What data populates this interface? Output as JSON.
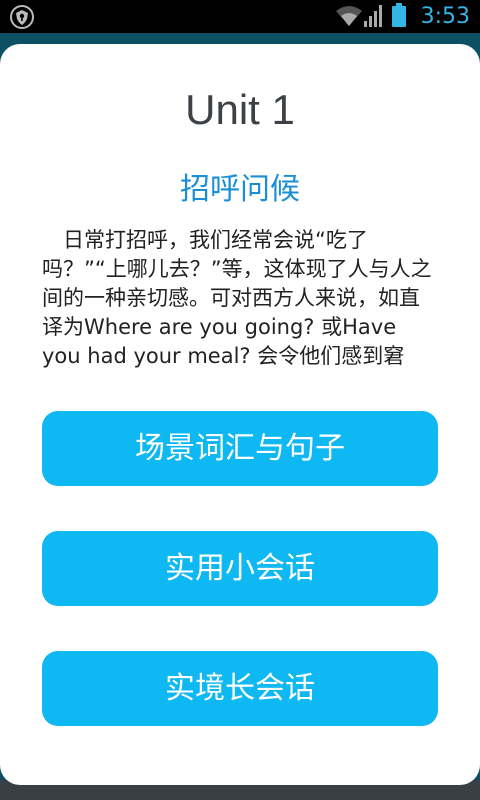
{
  "status_bar": {
    "time": "3:53",
    "icons": [
      "shield-notification-icon",
      "wifi-icon",
      "cell-signal-icon",
      "battery-icon"
    ],
    "accent_color": "#33b5e5"
  },
  "unit": {
    "title": "Unit 1",
    "subtitle": "招呼问候",
    "body": "日常打招呼，我们经常会说“吃了吗？”“上哪儿去？”等，这体现了人与人之间的一种亲切感。可对西方人来说，如直译为Where are you going? 或Have you had your meal? 会令他们感到窘然，尴尬，甚至不快，因为西方"
  },
  "buttons": {
    "scene_vocab": "场景词汇与句子",
    "short_dialogue": "实用小会话",
    "long_dialogue": "实境长会话",
    "color": "#0eb8f2"
  }
}
